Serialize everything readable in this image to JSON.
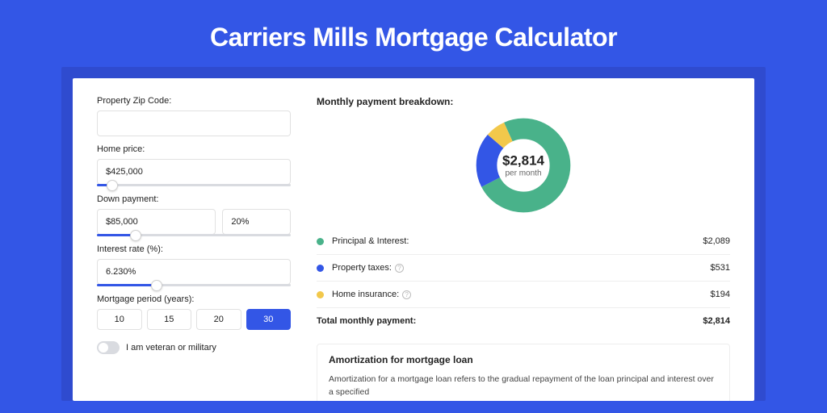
{
  "title": "Carriers Mills Mortgage Calculator",
  "form": {
    "zip_label": "Property Zip Code:",
    "zip_value": "",
    "home_price_label": "Home price:",
    "home_price_value": "$425,000",
    "home_price_slider_pct": 8,
    "down_payment_label": "Down payment:",
    "down_payment_value": "$85,000",
    "down_payment_pct_value": "20%",
    "down_payment_slider_pct": 20,
    "interest_label": "Interest rate (%):",
    "interest_value": "6.230%",
    "interest_slider_pct": 31,
    "period_label": "Mortgage period (years):",
    "period_options": [
      "10",
      "15",
      "20",
      "30"
    ],
    "period_selected_index": 3,
    "veteran_label": "I am veteran or military"
  },
  "breakdown": {
    "title": "Monthly payment breakdown:",
    "donut_amount": "$2,814",
    "donut_sub": "per month",
    "items": [
      {
        "label": "Principal & Interest:",
        "value": "$2,089",
        "color": "#49b28a",
        "has_info": false,
        "fraction": 0.742
      },
      {
        "label": "Property taxes:",
        "value": "$531",
        "color": "#3356e6",
        "has_info": true,
        "fraction": 0.189
      },
      {
        "label": "Home insurance:",
        "value": "$194",
        "color": "#f2c84b",
        "has_info": true,
        "fraction": 0.069
      }
    ],
    "total_label": "Total monthly payment:",
    "total_value": "$2,814"
  },
  "amortization": {
    "title": "Amortization for mortgage loan",
    "text": "Amortization for a mortgage loan refers to the gradual repayment of the loan principal and interest over a specified"
  },
  "chart_data": {
    "type": "pie",
    "title": "Monthly payment breakdown",
    "categories": [
      "Principal & Interest",
      "Property taxes",
      "Home insurance"
    ],
    "values": [
      2089,
      531,
      194
    ],
    "colors": [
      "#49b28a",
      "#3356e6",
      "#f2c84b"
    ],
    "total": 2814,
    "center_label": "$2,814 per month"
  }
}
